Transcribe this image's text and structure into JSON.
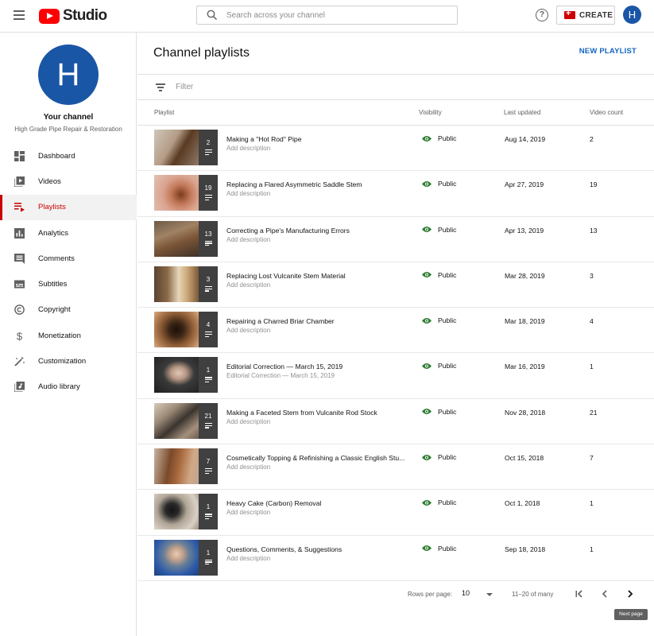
{
  "app": {
    "name": "Studio",
    "logo_icon": "youtube-play-icon"
  },
  "header": {
    "search_placeholder": "Search across your channel",
    "create_label": "CREATE",
    "avatar_letter": "H"
  },
  "sidebar": {
    "avatar_letter": "H",
    "channel_title": "Your channel",
    "channel_name": "High Grade Pipe Repair & Restoration",
    "items": [
      {
        "label": "Dashboard",
        "icon": "dashboard-icon",
        "active": false
      },
      {
        "label": "Videos",
        "icon": "video-library-icon",
        "active": false
      },
      {
        "label": "Playlists",
        "icon": "playlist-icon",
        "active": true
      },
      {
        "label": "Analytics",
        "icon": "analytics-icon",
        "active": false
      },
      {
        "label": "Comments",
        "icon": "comment-icon",
        "active": false
      },
      {
        "label": "Subtitles",
        "icon": "subtitles-icon",
        "active": false
      },
      {
        "label": "Copyright",
        "icon": "copyright-icon",
        "active": false
      },
      {
        "label": "Monetization",
        "icon": "dollar-icon",
        "active": false
      },
      {
        "label": "Customization",
        "icon": "magic-wand-icon",
        "active": false
      },
      {
        "label": "Audio library",
        "icon": "audio-library-icon",
        "active": false
      }
    ]
  },
  "main": {
    "title": "Channel playlists",
    "new_playlist_label": "NEW PLAYLIST",
    "filter_label": "Filter",
    "columns": {
      "playlist": "Playlist",
      "visibility": "Visibility",
      "updated": "Last updated",
      "count": "Video count"
    },
    "rows": [
      {
        "count": "2",
        "title": "Making a \"Hot Rod\" Pipe",
        "description": "Add description",
        "visibility": "Public",
        "updated": "Aug 14, 2019",
        "video_count": "2"
      },
      {
        "count": "19",
        "title": "Replacing a Flared Asymmetric Saddle Stem",
        "description": "Add description",
        "visibility": "Public",
        "updated": "Apr 27, 2019",
        "video_count": "19"
      },
      {
        "count": "13",
        "title": "Correcting a Pipe's Manufacturing Errors",
        "description": "Add description",
        "visibility": "Public",
        "updated": "Apr 13, 2019",
        "video_count": "13"
      },
      {
        "count": "3",
        "title": "Replacing Lost Vulcanite Stem Material",
        "description": "Add description",
        "visibility": "Public",
        "updated": "Mar 28, 2019",
        "video_count": "3"
      },
      {
        "count": "4",
        "title": "Repairing a Charred Briar Chamber",
        "description": "Add description",
        "visibility": "Public",
        "updated": "Mar 18, 2019",
        "video_count": "4"
      },
      {
        "count": "1",
        "title": "Editorial Correction — March 15, 2019",
        "description": "Editorial Correction — March 15, 2019",
        "visibility": "Public",
        "updated": "Mar 16, 2019",
        "video_count": "1"
      },
      {
        "count": "21",
        "title": "Making a Faceted Stem from Vulcanite Rod Stock",
        "description": "Add description",
        "visibility": "Public",
        "updated": "Nov 28, 2018",
        "video_count": "21"
      },
      {
        "count": "7",
        "title": "Cosmetically Topping & Refinishing a Classic English Stu...",
        "description": "Add description",
        "visibility": "Public",
        "updated": "Oct 15, 2018",
        "video_count": "7"
      },
      {
        "count": "1",
        "title": "Heavy Cake (Carbon) Removal",
        "description": "Add description",
        "visibility": "Public",
        "updated": "Oct 1, 2018",
        "video_count": "1"
      },
      {
        "count": "1",
        "title": "Questions, Comments, & Suggestions",
        "description": "Add description",
        "visibility": "Public",
        "updated": "Sep 18, 2018",
        "video_count": "1"
      }
    ],
    "pagination": {
      "rows_per_page_label": "Rows per page:",
      "rows_per_page_value": "10",
      "range": "11–20 of many",
      "tooltip": "Next page"
    }
  },
  "colors": {
    "accent_red": "#cc0000",
    "link_blue": "#1565c0",
    "avatar_blue": "#1a56a6",
    "public_green": "#2e7d32"
  }
}
